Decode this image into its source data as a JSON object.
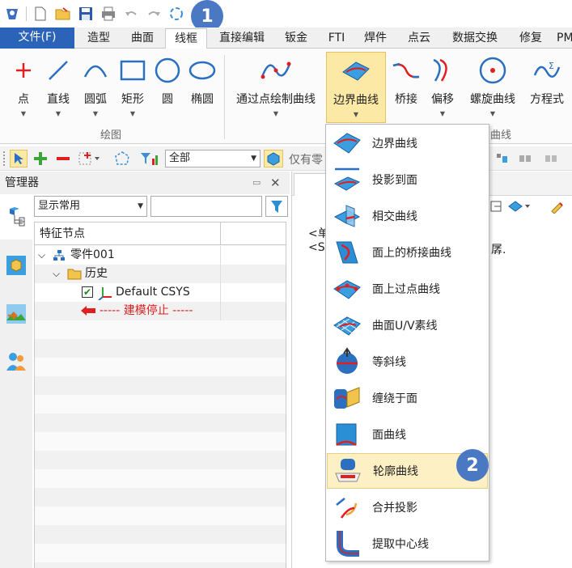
{
  "badges": {
    "one": "1",
    "two": "2"
  },
  "tabs": [
    {
      "label": "文件(F)"
    },
    {
      "label": "造型"
    },
    {
      "label": "曲面"
    },
    {
      "label": "线框"
    },
    {
      "label": "直接编辑"
    },
    {
      "label": "钣金"
    },
    {
      "label": "FTI"
    },
    {
      "label": "焊件"
    },
    {
      "label": "点云"
    },
    {
      "label": "数据交换"
    },
    {
      "label": "修复"
    },
    {
      "label": "PM"
    }
  ],
  "ribbon": {
    "buttons": [
      {
        "label": "点"
      },
      {
        "label": "直线"
      },
      {
        "label": "圆弧"
      },
      {
        "label": "矩形"
      },
      {
        "label": "圆"
      },
      {
        "label": "椭圆"
      },
      {
        "label": "通过点绘制曲线"
      },
      {
        "label": "边界曲线"
      },
      {
        "label": "桥接"
      },
      {
        "label": "偏移"
      },
      {
        "label": "螺旋曲线"
      },
      {
        "label": "方程式"
      }
    ],
    "group_draw": "绘图",
    "group_curve": "曲线"
  },
  "toolbar2": {
    "filter_select": "全部",
    "only_text": "仅有零"
  },
  "manager": {
    "title": "管理器",
    "display_select": "显示常用",
    "search_value": "",
    "col_header": "特征节点",
    "rows": [
      {
        "label": "零件001"
      },
      {
        "label": "历史"
      },
      {
        "label": "Default CSYS"
      },
      {
        "label": "----- 建模停止 -----"
      }
    ]
  },
  "doc": {
    "line1": "<单",
    "line2": "<Sh",
    "line2_tail": "孱."
  },
  "menu": {
    "items": [
      {
        "label": "边界曲线"
      },
      {
        "label": "投影到面"
      },
      {
        "label": "相交曲线"
      },
      {
        "label": "面上的桥接曲线"
      },
      {
        "label": "面上过点曲线"
      },
      {
        "label": "曲面U/V素线"
      },
      {
        "label": "等斜线"
      },
      {
        "label": "缠绕于面"
      },
      {
        "label": "面曲线"
      },
      {
        "label": "轮廓曲线"
      },
      {
        "label": "合并投影"
      },
      {
        "label": "提取中心线"
      }
    ]
  },
  "colors": {
    "file_tab": "#2b63b8",
    "badge": "#4a78c2",
    "highlight": "#fde9a6",
    "stop_red": "#e02020"
  }
}
